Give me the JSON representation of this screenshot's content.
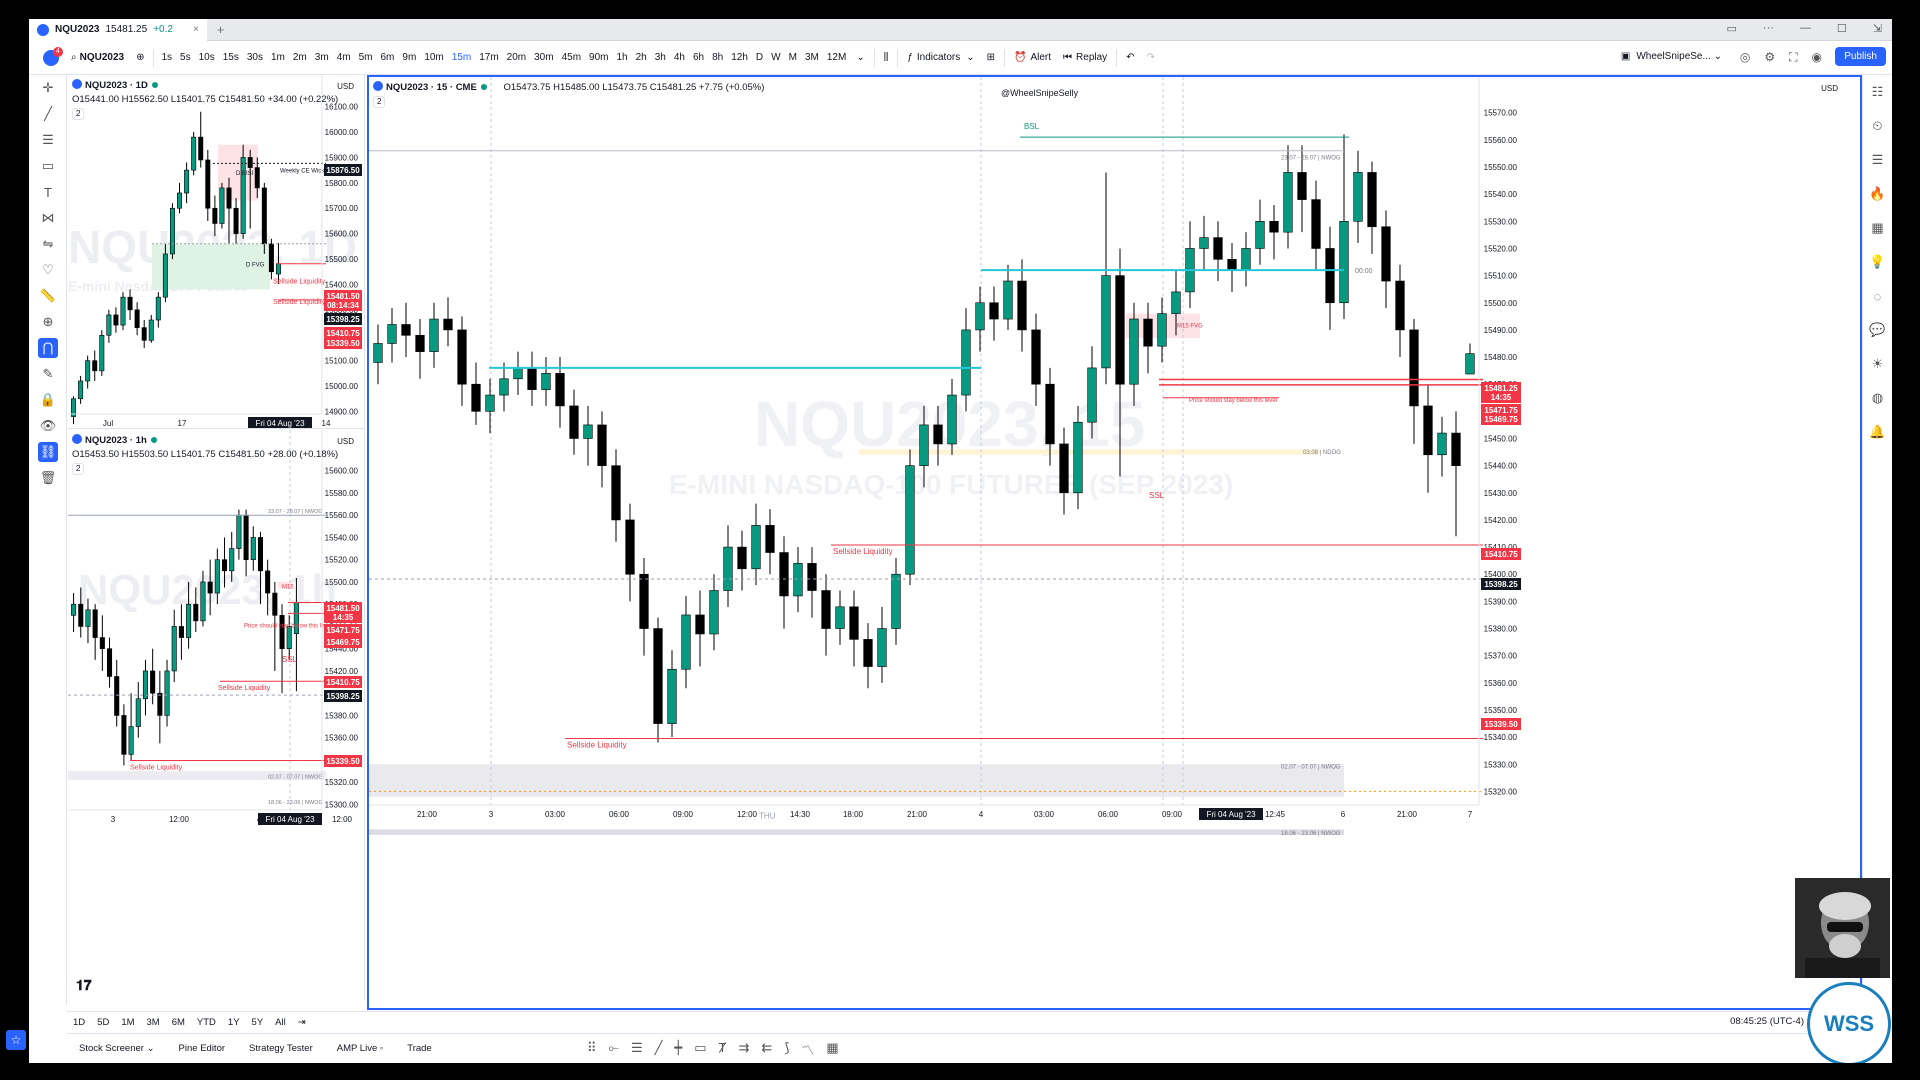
{
  "browser_tab": {
    "title": "NQU2023",
    "price": "15481.25",
    "change": "+0.2",
    "close": "×",
    "new_tab": "+"
  },
  "toolbar": {
    "symbol": "NQU2023",
    "intervals": [
      "1s",
      "5s",
      "10s",
      "15s",
      "30s",
      "1m",
      "2m",
      "3m",
      "4m",
      "5m",
      "6m",
      "9m",
      "10m",
      "15m",
      "17m",
      "20m",
      "30m",
      "45m",
      "90m",
      "1h",
      "2h",
      "3h",
      "4h",
      "6h",
      "8h",
      "12h",
      "D",
      "W",
      "M",
      "3M",
      "12M"
    ],
    "active_interval": "15m",
    "indicators": "Indicators",
    "alert": "Alert",
    "replay": "Replay",
    "layout_name": "WheelSnipeSe...",
    "publish": "Publish",
    "avatar_badge": "4"
  },
  "charts": {
    "daily": {
      "symbol": "NQU2023 · 1D",
      "ohlc": "O15441.00 H15562.50 L15401.75 C15481.50 +34.00 (+0.22%)",
      "indicator_count": "2",
      "currency": "USD",
      "watermark": "NQU2023, 1D",
      "watermark_sub": "E-mini Nasdaq-100 Futures",
      "x_labels": [
        "Jul",
        "17",
        "Fri 04 Aug '23",
        "14"
      ],
      "y_labels": [
        "16100.00",
        "16000.00",
        "15900.00",
        "15800.00",
        "15700.00",
        "15600.00",
        "15500.00",
        "15400.00",
        "15300.00",
        "15200.00",
        "15100.00",
        "15000.00",
        "14900.00"
      ],
      "annotations": {
        "weekly": "Weekly CE Wick",
        "bisi": "D BISI",
        "fvg": "D FVG",
        "ssl1": "Sellside Liquidity",
        "ssl2": "Sellside Liquidity"
      },
      "price_tags": [
        {
          "label": "15876.50",
          "color": "#131722"
        },
        {
          "label": "15481.50",
          "color": "#f23645"
        },
        {
          "label": "08:14:34",
          "color": "#f23645"
        },
        {
          "label": "15398.25",
          "color": "#131722"
        },
        {
          "label": "15410.75",
          "color": "#f23645"
        },
        {
          "label": "15339.50",
          "color": "#f23645"
        }
      ]
    },
    "hourly": {
      "symbol": "NQU2023 · 1h",
      "ohlc": "O15453.50 H15503.50 L15401.75 C15481.50 +28.00 (+0.18%)",
      "indicator_count": "2",
      "currency": "USD",
      "watermark": "NQU2023, 1h",
      "x_labels": [
        "3",
        "12:00",
        "4",
        "Fri 04 Aug '23",
        "12:00"
      ],
      "y_labels": [
        "15600.00",
        "15580.00",
        "15560.00",
        "15540.00",
        "15520.00",
        "15500.00",
        "15480.00",
        "15460.00",
        "15440.00",
        "15420.00",
        "15400.00",
        "15380.00",
        "15360.00",
        "15340.00",
        "15320.00",
        "15300.00"
      ],
      "annotations": {
        "nwog1": "23.07 - 28.07 | NWOG",
        "m15": "M15",
        "stay": "Price should stay below this level",
        "ssl": "SSL",
        "ssl_liq": "Sellside Liquidity",
        "ssl_liq2": "Sellside Liquidity",
        "nwog2": "02.07 - 07.07 | NWOG",
        "nwog3": "18.06 - 23.06 | NWOG"
      },
      "price_tags": [
        {
          "label": "15481.50",
          "color": "#f23645"
        },
        {
          "label": "14:35",
          "color": "#f23645"
        },
        {
          "label": "15471.75",
          "color": "#f23645"
        },
        {
          "label": "15469.75",
          "color": "#f23645"
        },
        {
          "label": "15410.75",
          "color": "#f23645"
        },
        {
          "label": "15398.25",
          "color": "#131722"
        },
        {
          "label": "15339.50",
          "color": "#f23645"
        }
      ]
    },
    "main": {
      "symbol": "NQU2023 · 15 · CME",
      "ohlc": "O15473.75 H15485.00 L15473.75 C15481.25 +7.75 (+0.05%)",
      "indicator_count": "2",
      "currency": "USD",
      "watermark_handle": "@WheelSnipeSelly",
      "watermark": "NQU2023, 15",
      "watermark_sub": "E-MINI NASDAQ-100 FUTURES (SEP 2023)",
      "x_labels": [
        "21:00",
        "3",
        "03:00",
        "06:00",
        "09:00",
        "12:00",
        "14:30",
        "18:00",
        "21:00",
        "4",
        "03:00",
        "06:00",
        "09:00",
        "Fri 04 Aug '23",
        "12:45",
        "6",
        "21:00",
        "7"
      ],
      "y_labels": [
        "15570.00",
        "15560.00",
        "15550.00",
        "15540.00",
        "15530.00",
        "15520.00",
        "15510.00",
        "15500.00",
        "15490.00",
        "15480.00",
        "15470.00",
        "15460.00",
        "15450.00",
        "15440.00",
        "15430.00",
        "15420.00",
        "15410.00",
        "15400.00",
        "15390.00",
        "15380.00",
        "15370.00",
        "15360.00",
        "15350.00",
        "15340.00",
        "15330.00",
        "15320.00"
      ],
      "annotations": {
        "bsl": "BSL",
        "nwog_top": "23.07 - 28.07 | NWOG",
        "time_0000": "00:00",
        "m15fvg": "M15 FVG",
        "stay": "Price should stay below this level",
        "ndog": "03.08 | NDOG",
        "ssl": "SSL",
        "ssl_liq1": "Sellside Liquidity",
        "ssl_liq2": "Sellside Liquidity",
        "nwog_mid": "02.07 - 07.07 | NWOG",
        "thu": "THU",
        "nwog_low": "18.06 - 23.06 | NWOG"
      },
      "price_tags": [
        {
          "label": "15481.25",
          "color": "#f23645"
        },
        {
          "label": "14:35",
          "color": "#f23645"
        },
        {
          "label": "15471.75",
          "color": "#f23645"
        },
        {
          "label": "15469.75",
          "color": "#f23645"
        },
        {
          "label": "15410.75",
          "color": "#f23645"
        },
        {
          "label": "15398.25",
          "color": "#131722"
        },
        {
          "label": "15339.50",
          "color": "#f23645"
        }
      ]
    }
  },
  "chart_data": [
    {
      "type": "candlestick",
      "title": "NQU2023 · 1D",
      "ylim": [
        14890,
        16130
      ],
      "levels": [
        {
          "name": "Weekly CE Wick",
          "price": 15876.5
        },
        {
          "name": "Sellside Liquidity",
          "price": 15410.75
        },
        {
          "name": "Sellside Liquidity",
          "price": 15339.5
        }
      ],
      "candles": [
        [
          14880,
          14950,
          14850,
          14960
        ],
        [
          14950,
          15020,
          14930,
          15040
        ],
        [
          15020,
          15100,
          14990,
          15120
        ],
        [
          15100,
          15060,
          15020,
          15140
        ],
        [
          15060,
          15200,
          15040,
          15220
        ],
        [
          15200,
          15280,
          15170,
          15300
        ],
        [
          15280,
          15240,
          15210,
          15310
        ],
        [
          15240,
          15350,
          15220,
          15370
        ],
        [
          15350,
          15300,
          15260,
          15380
        ],
        [
          15300,
          15230,
          15200,
          15330
        ],
        [
          15230,
          15180,
          15150,
          15260
        ],
        [
          15180,
          15260,
          15170,
          15280
        ],
        [
          15260,
          15350,
          15230,
          15370
        ],
        [
          15350,
          15520,
          15330,
          15560
        ],
        [
          15520,
          15700,
          15500,
          15720
        ],
        [
          15700,
          15760,
          15680,
          15800
        ],
        [
          15760,
          15850,
          15720,
          15880
        ],
        [
          15850,
          15980,
          15830,
          16000
        ],
        [
          15980,
          15890,
          15860,
          16080
        ],
        [
          15890,
          15700,
          15650,
          15930
        ],
        [
          15700,
          15640,
          15590,
          15750
        ],
        [
          15640,
          15780,
          15620,
          15800
        ],
        [
          15780,
          15700,
          15560,
          15820
        ],
        [
          15700,
          15600,
          15560,
          15740
        ],
        [
          15600,
          15900,
          15580,
          15950
        ],
        [
          15900,
          15860,
          15620,
          15930
        ],
        [
          15860,
          15780,
          15740,
          15900
        ],
        [
          15780,
          15560,
          15520,
          15800
        ],
        [
          15560,
          15450,
          15420,
          15580
        ],
        [
          15441,
          15481.5,
          15401.75,
          15562.5
        ]
      ]
    },
    {
      "type": "candlestick",
      "title": "NQU2023 · 1h",
      "ylim": [
        15295,
        15615
      ],
      "levels": [
        {
          "name": "Sellside Liquidity",
          "price": 15410.75
        },
        {
          "name": "Sellside Liquidity",
          "price": 15339.5
        }
      ],
      "candles": [
        [
          15470,
          15480,
          15455,
          15490
        ],
        [
          15480,
          15460,
          15450,
          15495
        ],
        [
          15460,
          15475,
          15445,
          15485
        ],
        [
          15475,
          15450,
          15430,
          15480
        ],
        [
          15450,
          15440,
          15420,
          15470
        ],
        [
          15440,
          15415,
          15405,
          15450
        ],
        [
          15415,
          15380,
          15370,
          15430
        ],
        [
          15380,
          15345,
          15335,
          15390
        ],
        [
          15345,
          15370,
          15340,
          15400
        ],
        [
          15370,
          15395,
          15360,
          15410
        ],
        [
          15395,
          15420,
          15380,
          15430
        ],
        [
          15420,
          15400,
          15390,
          15440
        ],
        [
          15400,
          15380,
          15355,
          15420
        ],
        [
          15380,
          15420,
          15370,
          15430
        ],
        [
          15420,
          15460,
          15410,
          15475
        ],
        [
          15460,
          15450,
          15430,
          15480
        ],
        [
          15450,
          15480,
          15440,
          15500
        ],
        [
          15480,
          15465,
          15455,
          15495
        ],
        [
          15465,
          15500,
          15460,
          15510
        ],
        [
          15500,
          15490,
          15470,
          15520
        ],
        [
          15490,
          15520,
          15480,
          15530
        ],
        [
          15520,
          15510,
          15495,
          15540
        ],
        [
          15510,
          15530,
          15500,
          15545
        ],
        [
          15530,
          15560,
          15520,
          15565
        ],
        [
          15560,
          15520,
          15505,
          15565
        ],
        [
          15520,
          15540,
          15510,
          15550
        ],
        [
          15540,
          15510,
          15480,
          15545
        ],
        [
          15510,
          15490,
          15470,
          15520
        ],
        [
          15490,
          15470,
          15420,
          15500
        ],
        [
          15470,
          15440,
          15400,
          15480
        ],
        [
          15440,
          15460,
          15430,
          15470
        ],
        [
          15453.5,
          15481.5,
          15401.75,
          15503.5
        ]
      ]
    },
    {
      "type": "candlestick",
      "title": "NQU2023 · 15 · CME",
      "ylim": [
        15315,
        15578
      ],
      "levels": [
        {
          "name": "BSL",
          "price": 15561
        },
        {
          "name": "00:00",
          "price": 15512
        },
        {
          "name": "Sellside Liquidity",
          "price": 15410.75
        },
        {
          "name": "Sellside Liquidity",
          "price": 15339.5
        }
      ],
      "candles": [
        [
          15478,
          15485,
          15470,
          15492
        ],
        [
          15485,
          15492,
          15478,
          15498
        ],
        [
          15492,
          15488,
          15480,
          15500
        ],
        [
          15488,
          15482,
          15472,
          15494
        ],
        [
          15482,
          15494,
          15476,
          15500
        ],
        [
          15494,
          15490,
          15484,
          15502
        ],
        [
          15490,
          15470,
          15462,
          15495
        ],
        [
          15470,
          15460,
          15455,
          15478
        ],
        [
          15460,
          15466,
          15452,
          15472
        ],
        [
          15466,
          15472,
          15460,
          15478
        ],
        [
          15472,
          15476,
          15466,
          15482
        ],
        [
          15476,
          15468,
          15462,
          15482
        ],
        [
          15468,
          15474,
          15462,
          15480
        ],
        [
          15474,
          15462,
          15454,
          15480
        ],
        [
          15462,
          15450,
          15444,
          15468
        ],
        [
          15450,
          15455,
          15440,
          15462
        ],
        [
          15455,
          15440,
          15432,
          15460
        ],
        [
          15440,
          15420,
          15412,
          15446
        ],
        [
          15420,
          15400,
          15390,
          15426
        ],
        [
          15400,
          15380,
          15370,
          15406
        ],
        [
          15380,
          15345,
          15338,
          15384
        ],
        [
          15345,
          15365,
          15340,
          15372
        ],
        [
          15365,
          15385,
          15358,
          15392
        ],
        [
          15385,
          15378,
          15366,
          15394
        ],
        [
          15378,
          15394,
          15372,
          15400
        ],
        [
          15394,
          15410,
          15388,
          15418
        ],
        [
          15410,
          15402,
          15394,
          15416
        ],
        [
          15402,
          15418,
          15396,
          15426
        ],
        [
          15418,
          15408,
          15400,
          15424
        ],
        [
          15408,
          15392,
          15380,
          15414
        ],
        [
          15392,
          15404,
          15386,
          15410
        ],
        [
          15404,
          15394,
          15384,
          15410
        ],
        [
          15394,
          15380,
          15370,
          15400
        ],
        [
          15380,
          15388,
          15374,
          15394
        ],
        [
          15388,
          15376,
          15366,
          15394
        ],
        [
          15376,
          15366,
          15358,
          15382
        ],
        [
          15366,
          15380,
          15360,
          15388
        ],
        [
          15380,
          15400,
          15374,
          15406
        ],
        [
          15400,
          15440,
          15396,
          15446
        ],
        [
          15440,
          15455,
          15432,
          15462
        ],
        [
          15455,
          15448,
          15440,
          15462
        ],
        [
          15448,
          15466,
          15444,
          15472
        ],
        [
          15466,
          15490,
          15460,
          15498
        ],
        [
          15490,
          15500,
          15482,
          15506
        ],
        [
          15500,
          15494,
          15486,
          15506
        ],
        [
          15494,
          15508,
          15490,
          15514
        ],
        [
          15508,
          15490,
          15482,
          15516
        ],
        [
          15490,
          15470,
          15462,
          15496
        ],
        [
          15470,
          15448,
          15440,
          15476
        ],
        [
          15448,
          15430,
          15422,
          15454
        ],
        [
          15430,
          15456,
          15424,
          15462
        ],
        [
          15456,
          15476,
          15450,
          15484
        ],
        [
          15476,
          15510,
          15470,
          15548
        ],
        [
          15510,
          15470,
          15436,
          15520
        ],
        [
          15470,
          15494,
          15462,
          15500
        ],
        [
          15494,
          15484,
          15474,
          15500
        ],
        [
          15484,
          15496,
          15478,
          15502
        ],
        [
          15496,
          15504,
          15488,
          15512
        ],
        [
          15504,
          15520,
          15498,
          15530
        ],
        [
          15520,
          15524,
          15512,
          15532
        ],
        [
          15524,
          15516,
          15508,
          15530
        ],
        [
          15516,
          15512,
          15504,
          15522
        ],
        [
          15512,
          15520,
          15506,
          15526
        ],
        [
          15520,
          15530,
          15514,
          15538
        ],
        [
          15530,
          15526,
          15516,
          15536
        ],
        [
          15526,
          15548,
          15520,
          15558
        ],
        [
          15548,
          15538,
          15526,
          15558
        ],
        [
          15538,
          15520,
          15512,
          15545
        ],
        [
          15520,
          15500,
          15490,
          15528
        ],
        [
          15500,
          15530,
          15494,
          15562
        ],
        [
          15530,
          15548,
          15522,
          15556
        ],
        [
          15548,
          15528,
          15518,
          15552
        ],
        [
          15528,
          15508,
          15498,
          15534
        ],
        [
          15508,
          15490,
          15480,
          15514
        ],
        [
          15490,
          15462,
          15448,
          15494
        ],
        [
          15462,
          15444,
          15430,
          15470
        ],
        [
          15444,
          15452,
          15436,
          15458
        ],
        [
          15452,
          15440,
          15414,
          15460
        ],
        [
          15473.75,
          15481.25,
          15473.75,
          15485
        ]
      ]
    }
  ]
}
